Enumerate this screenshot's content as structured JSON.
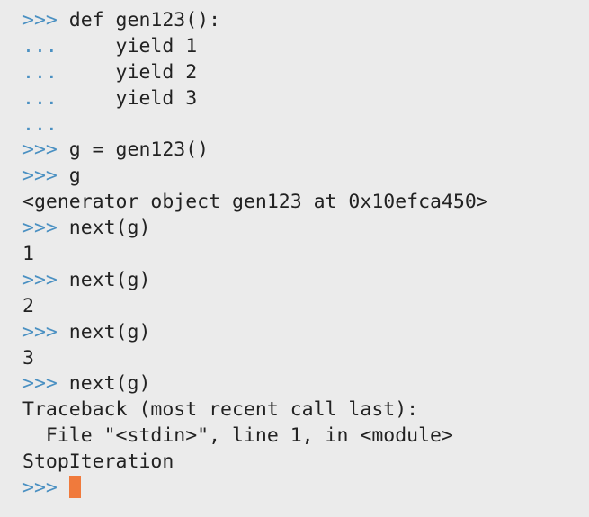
{
  "colors": {
    "background": "#ebebeb",
    "text": "#222222",
    "prompt": "#4a90c2",
    "cursor": "#f07a3c"
  },
  "lines": [
    {
      "prompt": ">>> ",
      "text": "def gen123():"
    },
    {
      "prompt": "... ",
      "text": "    yield 1"
    },
    {
      "prompt": "... ",
      "text": "    yield 2"
    },
    {
      "prompt": "... ",
      "text": "    yield 3"
    },
    {
      "prompt": "...",
      "text": ""
    },
    {
      "prompt": ">>> ",
      "text": "g = gen123()"
    },
    {
      "prompt": ">>> ",
      "text": "g"
    },
    {
      "prompt": "",
      "text": "<generator object gen123 at 0x10efca450>"
    },
    {
      "prompt": ">>> ",
      "text": "next(g)"
    },
    {
      "prompt": "",
      "text": "1"
    },
    {
      "prompt": ">>> ",
      "text": "next(g)"
    },
    {
      "prompt": "",
      "text": "2"
    },
    {
      "prompt": ">>> ",
      "text": "next(g)"
    },
    {
      "prompt": "",
      "text": "3"
    },
    {
      "prompt": ">>> ",
      "text": "next(g)"
    },
    {
      "prompt": "",
      "text": "Traceback (most recent call last):"
    },
    {
      "prompt": "",
      "text": "  File \"<stdin>\", line 1, in <module>"
    },
    {
      "prompt": "",
      "text": "StopIteration"
    }
  ],
  "active_prompt": ">>> "
}
